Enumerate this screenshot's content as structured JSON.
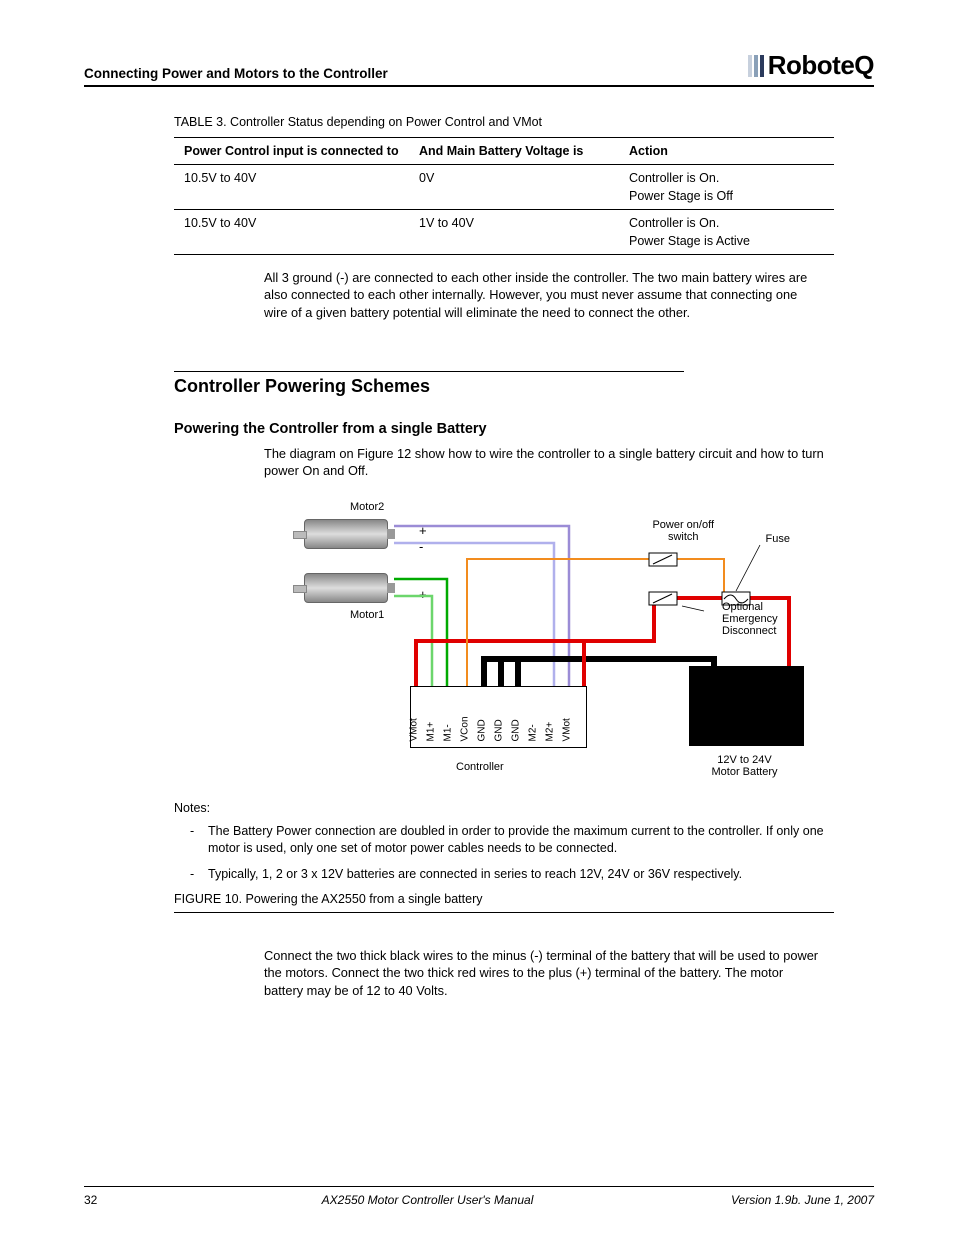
{
  "header": {
    "section": "Connecting Power and Motors to the Controller",
    "brand": "RoboteQ"
  },
  "table": {
    "caption": "TABLE 3. Controller Status depending on Power Control and VMot",
    "h1": "Power Control input is connected to",
    "h2": "And Main Battery Voltage is",
    "h3": "Action",
    "rows": [
      {
        "c1": "10.5V to 40V",
        "c2": "0V",
        "c3a": "Controller is On.",
        "c3b": "Power Stage is Off"
      },
      {
        "c1": "10.5V to 40V",
        "c2": "1V to 40V",
        "c3a": "Controller is On.",
        "c3b": "Power Stage is Active"
      }
    ]
  },
  "para1": "All 3 ground (-) are connected to each other inside the controller. The two main battery wires are also connected to each other internally. However, you must never assume that connecting one wire of a given battery potential will eliminate the need to connect the other.",
  "sec": "Controller Powering Schemes",
  "sub": "Powering the Controller from a single Battery",
  "para2": "The diagram on Figure 12 show how to wire the controller to a single battery circuit and how to turn power On and Off.",
  "diagram": {
    "motor2": "Motor2",
    "motor1": "Motor1",
    "controller": "Controller",
    "battery": "12V to 24V\nMotor Battery",
    "switch": "Power on/off\nswitch",
    "fuse": "Fuse",
    "optional": "Optional Emergency Disconnect",
    "pins": [
      "VMot",
      "M1+",
      "M1-",
      "VCon",
      "GND",
      "GND",
      "GND",
      "M2-",
      "M2+",
      "VMot"
    ]
  },
  "notes_h": "Notes:",
  "notes": [
    "The Battery Power connection are doubled in order to provide the maximum current to the controller. If only one motor is used, only one set of motor power cables needs to be connected.",
    "Typically, 1, 2 or 3 x 12V batteries are connected in series to reach 12V, 24V or 36V respectively."
  ],
  "fig": "FIGURE 10.  Powering the AX2550 from a single battery",
  "para3": "Connect the two thick black wires to the minus (-) terminal of the battery that will be used to power the motors. Connect the two thick red wires to the plus (+) terminal of the battery. The motor battery may be of 12 to 40 Volts.",
  "footer": {
    "page": "32",
    "title": "AX2550 Motor Controller User's Manual",
    "version": "Version 1.9b. June 1, 2007"
  }
}
